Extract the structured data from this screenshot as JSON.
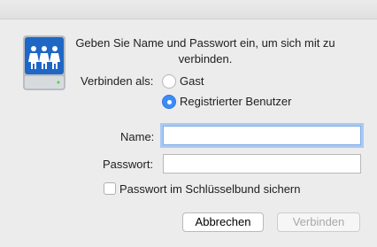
{
  "dialog": {
    "message": "Geben Sie Name und Passwort ein, um sich mit zu verbinden.",
    "connect_as_label": "Verbinden als:",
    "radio_options": [
      {
        "label": "Gast",
        "selected": false
      },
      {
        "label": "Registrierter Benutzer",
        "selected": true
      }
    ],
    "name_label": "Name:",
    "name_value": "",
    "password_label": "Passwort:",
    "password_value": "",
    "keychain_label": "Passwort im Schlüsselbund sichern",
    "keychain_checked": false,
    "cancel_label": "Abbrechen",
    "connect_label": "Verbinden",
    "connect_enabled": false
  },
  "icons": {
    "server": "network-server-people-icon"
  },
  "colors": {
    "accent": "#3d8cf6",
    "focus_ring": "#a9c9f2",
    "server_blue": "#1f67c4"
  }
}
